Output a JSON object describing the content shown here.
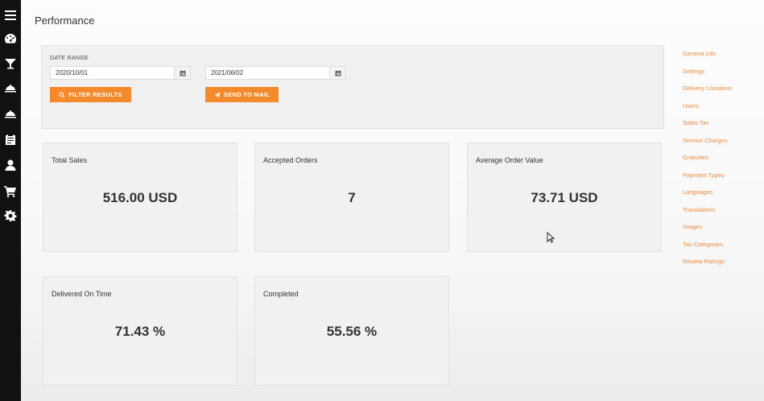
{
  "page": {
    "title": "Performance"
  },
  "filters": {
    "date_range_label": "DATE RANGE",
    "start_date": "2020/10/01",
    "end_date": "2021/06/02",
    "filter_button": "FILTER RESULTS",
    "mail_button": "SEND TO MAIL"
  },
  "cards": [
    {
      "label": "Total Sales",
      "value": "516.00 USD"
    },
    {
      "label": "Accepted Orders",
      "value": "7"
    },
    {
      "label": "Average Order Value",
      "value": "73.71 USD"
    },
    {
      "label": "Delivered On Time",
      "value": "71.43 %"
    },
    {
      "label": "Completed",
      "value": "55.56 %"
    }
  ],
  "right_nav": [
    "General Info",
    "Settings",
    "Delivery Locations",
    "Users",
    "Sales Tax",
    "Service Charges",
    "Gratuities",
    "Payment Types",
    "Languages",
    "Translations",
    "Images",
    "Tax Categories",
    "Review Ratings"
  ],
  "sidebar_icons": [
    "menu-icon",
    "dashboard-icon",
    "cocktail-icon",
    "cloche-icon",
    "cloche-icon",
    "clipboard-icon",
    "user-icon",
    "cart-icon",
    "gear-icon"
  ],
  "colors": {
    "accent": "#f58a2c",
    "link": "#f08a3c",
    "sidebar": "#111111"
  }
}
